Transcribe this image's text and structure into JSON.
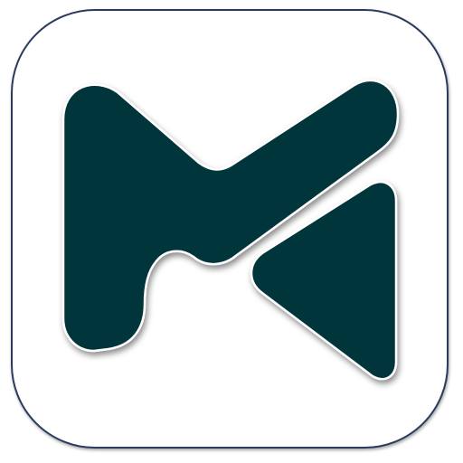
{
  "icon": {
    "name": "app-logo-icon",
    "colors": {
      "tile_background": "#ffffff",
      "tile_border": "#2a3a5e",
      "mark_fill": "#04343b",
      "mark_outline": "#ffffff",
      "shadow": "#000000"
    }
  }
}
